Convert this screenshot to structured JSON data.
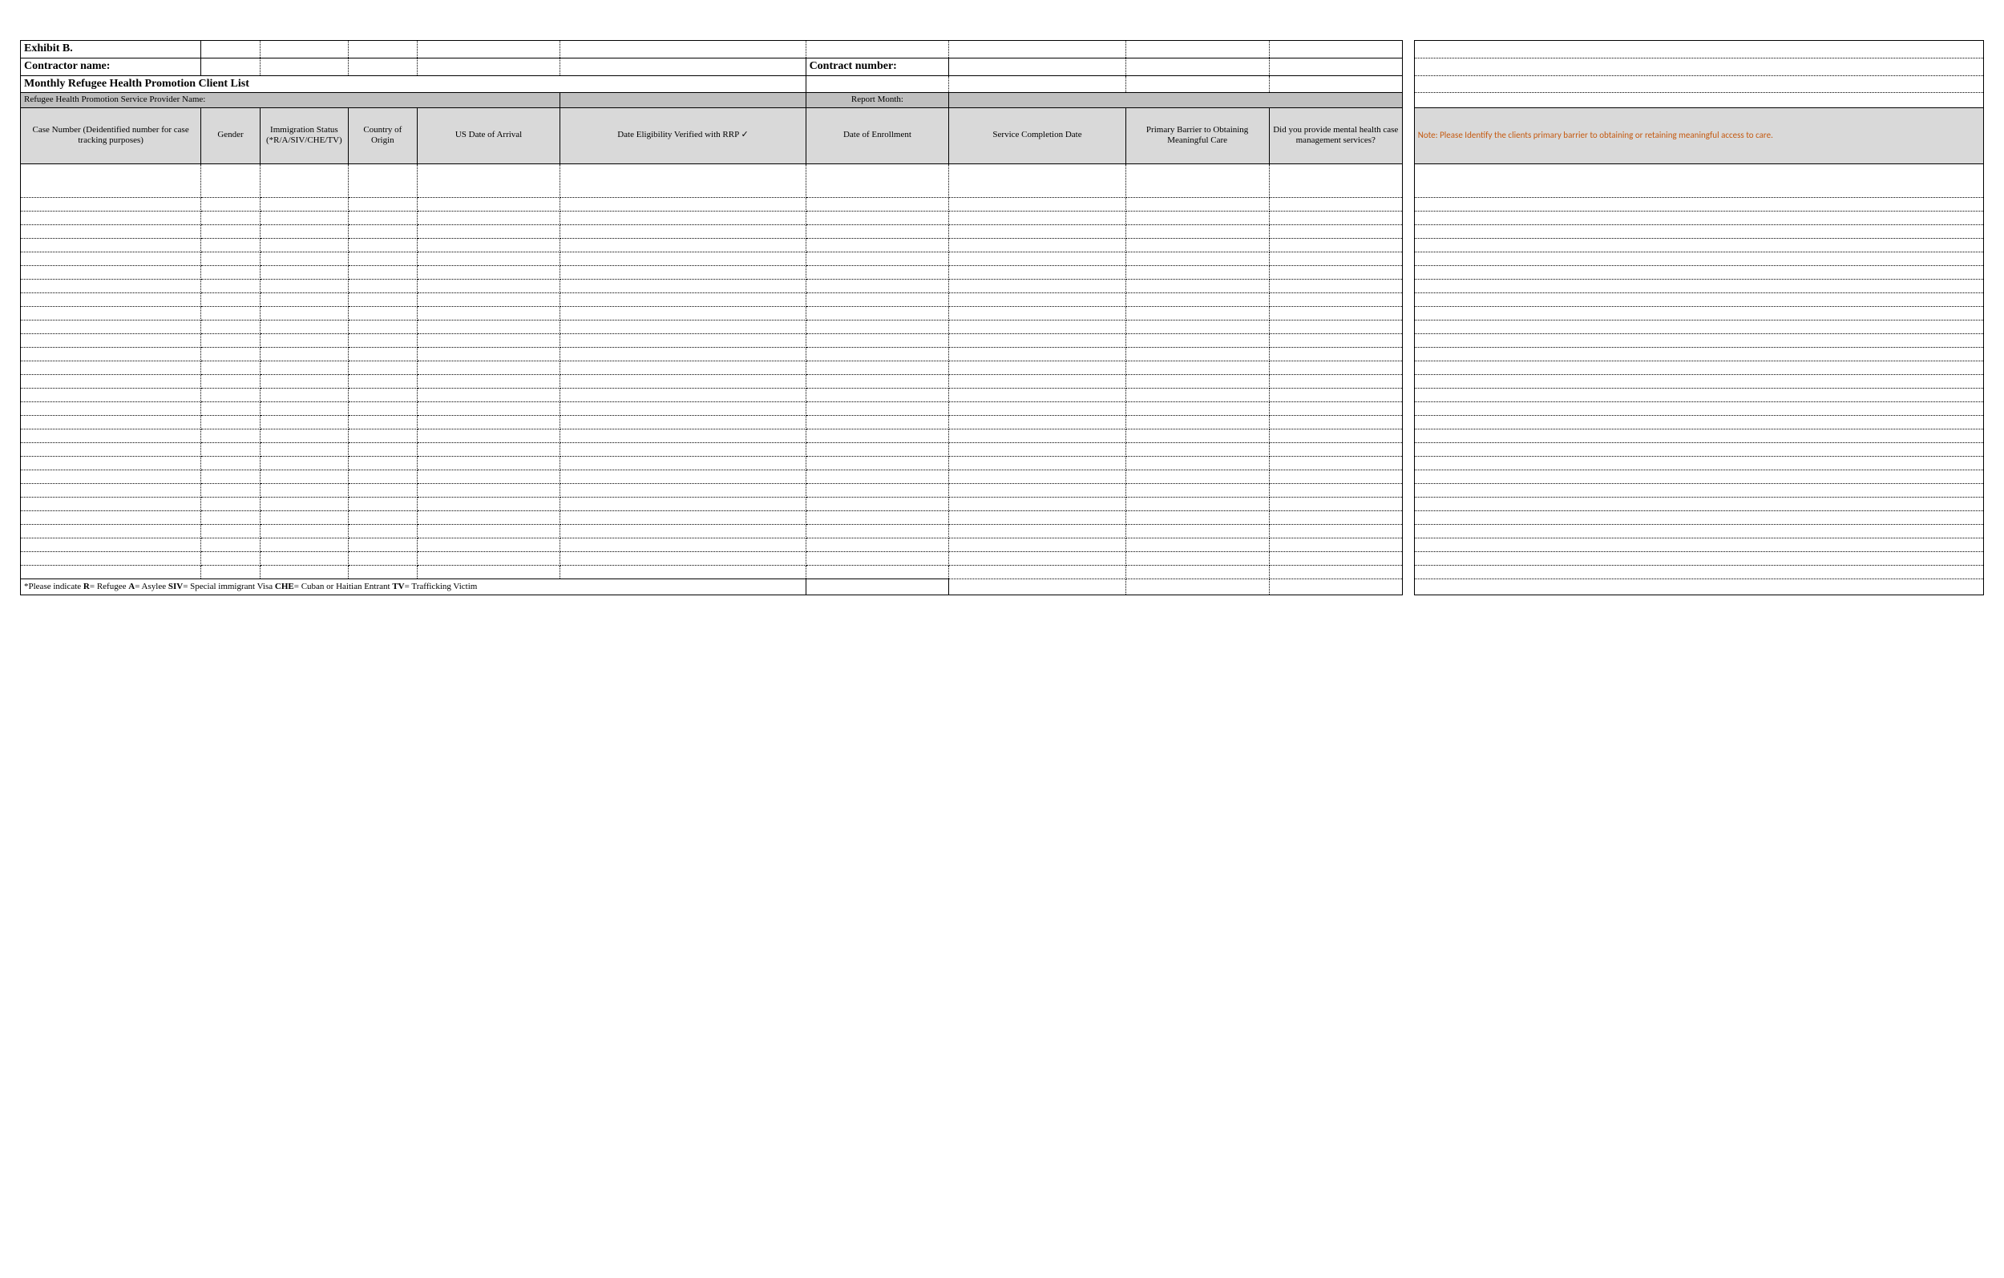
{
  "header": {
    "exhibit_label": "Exhibit B.",
    "contractor_label": "Contractor name:",
    "contract_number_label": "Contract number:",
    "list_title": "Monthly Refugee Health Promotion Client List",
    "provider_name_label": "Refugee Health Promotion Service Provider Name:",
    "report_month_label": "Report Month:"
  },
  "columns": {
    "c1": "Case Number (Deidentified number for case tracking purposes)",
    "c2": "Gender",
    "c3": "Immigration Status (*R/A/SIV/CHE/TV)",
    "c4": "Country of Origin",
    "c5": "US Date of Arrival",
    "c6": "Date Eligibility Verified with RRP ✓",
    "c7": "Date of Enrollment",
    "c8": "Service Completion Date",
    "c9": "Primary Barrier to Obtaining Meaningful Care",
    "c10": "Did you provide mental health case management services?"
  },
  "note": "Note: Please Identify the clients primary barrier to obtaining or retaining meaningful access to care.",
  "footnote_prefix": "*Please indicate ",
  "footnote_r": "R",
  "footnote_r_txt": "= Refugee ",
  "footnote_a": "A",
  "footnote_a_txt": "= Asylee ",
  "footnote_siv": "SIV",
  "footnote_siv_txt": "= Special immigrant Visa ",
  "footnote_che": "CHE",
  "footnote_che_txt": "=  Cuban or Haitian Entrant ",
  "footnote_tv": "TV",
  "footnote_tv_txt": "= Trafficking Victim",
  "data_row_count": 29
}
